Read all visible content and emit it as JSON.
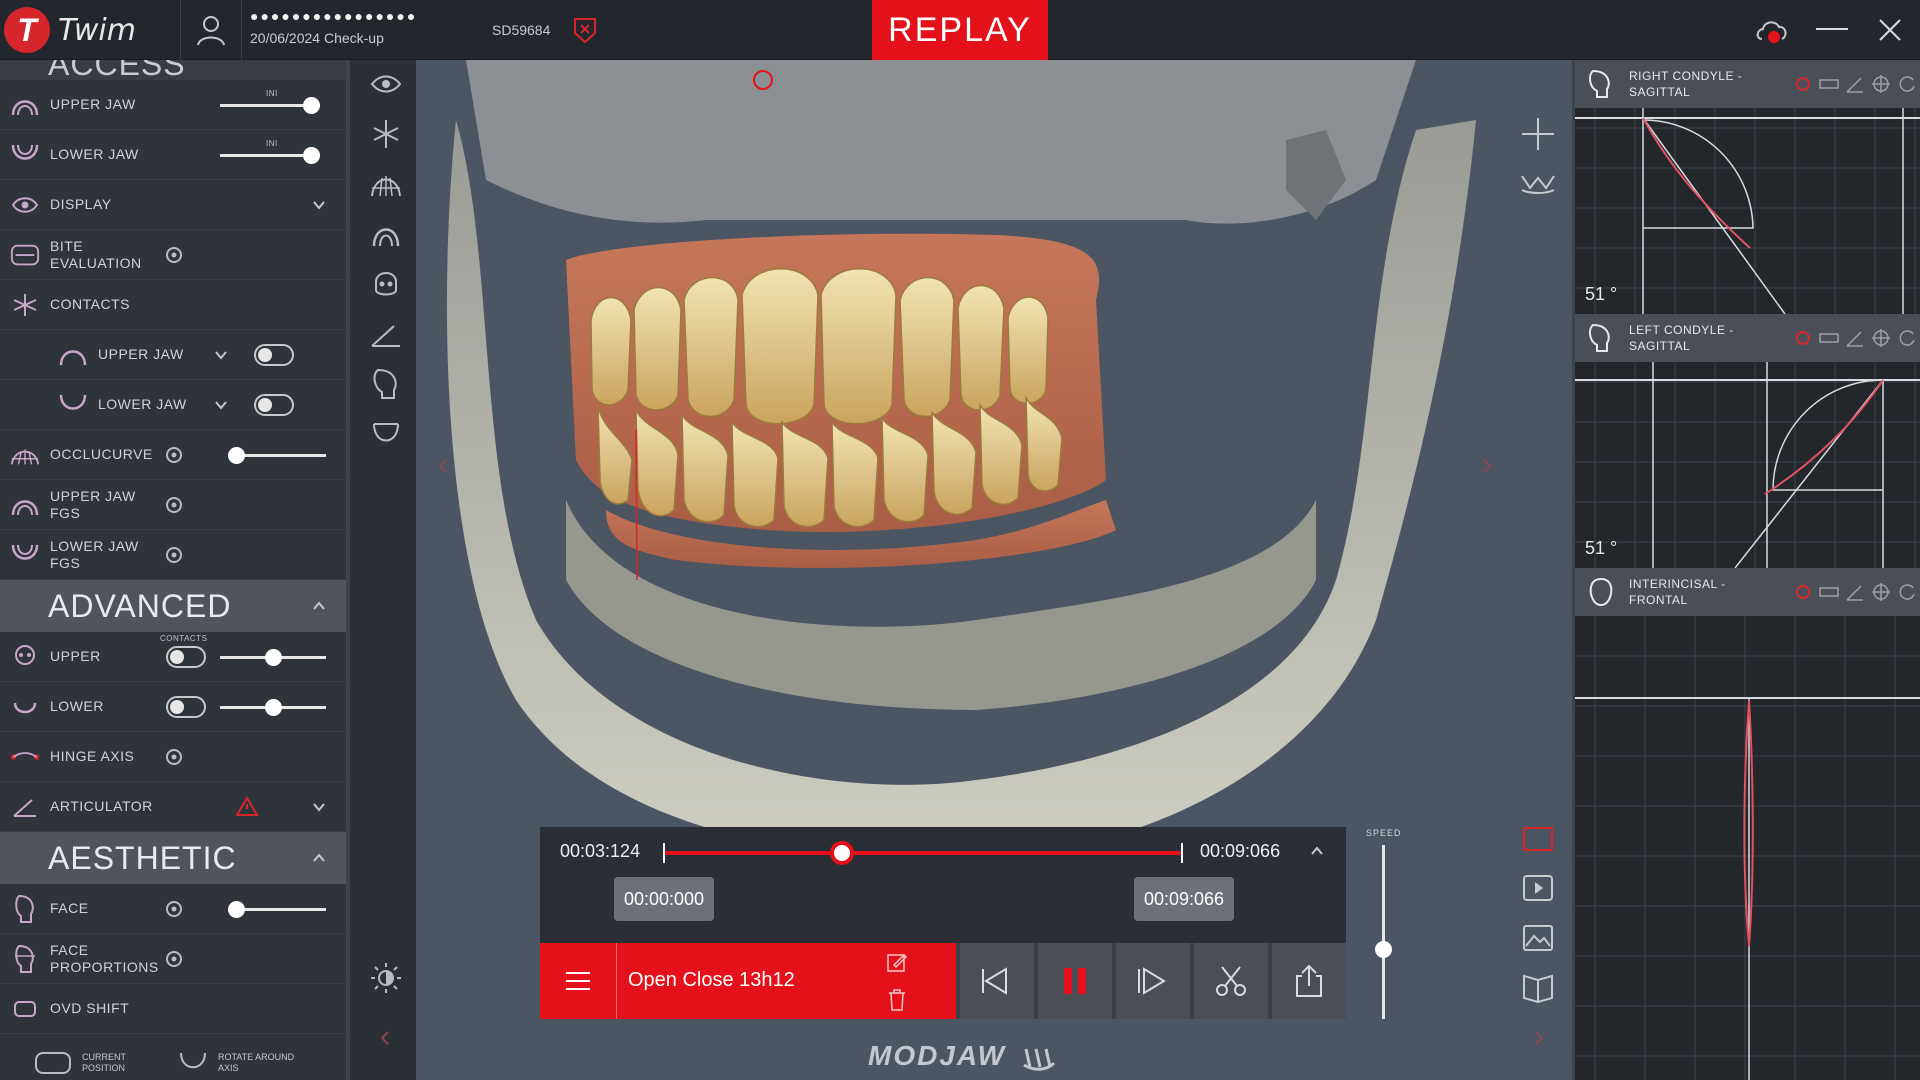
{
  "app": {
    "name": "Twim",
    "logo_letter": "T"
  },
  "patient": {
    "masked_name": "●●●●●●●●●●●●●●●●",
    "id": "SD59684",
    "session": "20/06/2024 Check-up"
  },
  "mode_label": "REPLAY",
  "sidebar": {
    "cut_header": "ACCESS",
    "rows": [
      {
        "label": "UPPER JAW",
        "icon": "upper-jaw-icon",
        "control": "slider",
        "mini": "INI",
        "value": 1.0
      },
      {
        "label": "LOWER JAW",
        "icon": "lower-jaw-icon",
        "control": "slider",
        "mini": "INI",
        "value": 1.0
      },
      {
        "label": "DISPLAY",
        "icon": "eye-icon",
        "control": "chevron"
      },
      {
        "label": "BITE EVALUATION",
        "icon": "bite-icon",
        "control": "gear"
      },
      {
        "label": "CONTACTS",
        "icon": "contacts-icon",
        "control": "none"
      },
      {
        "label": "UPPER JAW",
        "icon": "upper-jaw-icon",
        "control": "toggle-chevron",
        "sub": true
      },
      {
        "label": "LOWER JAW",
        "icon": "lower-jaw-icon",
        "control": "toggle-chevron",
        "sub": true
      },
      {
        "label": "OCCLUCURVE",
        "icon": "occlucurve-icon",
        "control": "gear-slider",
        "value": 0.0
      },
      {
        "label": "UPPER JAW FGS",
        "icon": "upper-jaw-icon",
        "control": "gear"
      },
      {
        "label": "LOWER JAW FGS",
        "icon": "lower-jaw-icon",
        "control": "gear"
      }
    ],
    "section_advanced": "ADVANCED",
    "advanced_rows": [
      {
        "label": "UPPER",
        "mini": "CONTACTS",
        "value": 0.5
      },
      {
        "label": "LOWER",
        "value": 0.5
      }
    ],
    "hinge_axis": "HINGE AXIS",
    "articulator": "ARTICULATOR",
    "section_aesthetic": "AESTHETIC",
    "face": "FACE",
    "face_value": 0.0,
    "face_proportions": "FACE PROPORTIONS",
    "ovd_shift": "OVD SHIFT",
    "current_position": "CURRENT POSITION",
    "rotate_around_axis": "ROTATE AROUND AXIS"
  },
  "panels": [
    {
      "title": "RIGHT CONDYLE - SAGITTAL",
      "angle": "51 °"
    },
    {
      "title": "LEFT CONDYLE - SAGITTAL",
      "angle": "51 °"
    },
    {
      "title": "INTERINCISAL - FRONTAL"
    }
  ],
  "player": {
    "current_time": "00:03:124",
    "end_time": "00:09:066",
    "range_start": "00:00:000",
    "range_end": "00:09:066",
    "progress": 0.345,
    "clip_name": "Open Close 13h12",
    "speed_label": "SPEED",
    "speed": 0.4
  },
  "brand": "MODJAW",
  "colors": {
    "accent": "#e4111a",
    "panel": "#2f333a",
    "viewport": "#4c5562"
  }
}
